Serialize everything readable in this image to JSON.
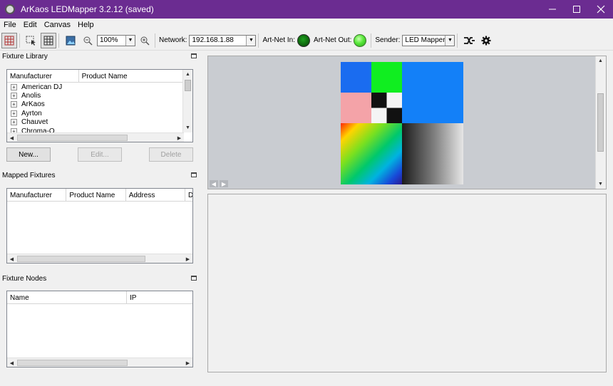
{
  "window": {
    "title": "ArKaos LEDMapper 3.2.12 (saved)",
    "minimize_icon": "minimize-icon",
    "maximize_icon": "maximize-icon",
    "close_icon": "close-icon"
  },
  "menu": [
    "File",
    "Edit",
    "Canvas",
    "Help"
  ],
  "toolbar": {
    "zoom_value": "100%",
    "network_label": "Network:",
    "network_value": "192.168.1.88",
    "artnet_in_label": "Art-Net In:",
    "artnet_out_label": "Art-Net Out:",
    "sender_label": "Sender:",
    "sender_value": "LED Mapper",
    "artnet_in_color": "#0f7a0f",
    "artnet_out_color": "#58e83a"
  },
  "fixture_library": {
    "title": "Fixture Library",
    "columns": [
      "Manufacturer",
      "Product Name"
    ],
    "items": [
      "American DJ",
      "Anolis",
      "ArKaos",
      "Ayrton",
      "Chauvet",
      "Chroma-Q"
    ],
    "new_button": "New...",
    "edit_button": "Edit...",
    "delete_button": "Delete"
  },
  "mapped_fixtures": {
    "title": "Mapped Fixtures",
    "columns": [
      "Manufacturer",
      "Product Name",
      "Address",
      "D"
    ]
  },
  "fixture_nodes": {
    "title": "Fixture Nodes",
    "columns": [
      "Name",
      "IP"
    ]
  },
  "canvas": {
    "colors": {
      "blue": "#1a6cf0",
      "green": "#10ee20",
      "pink": "#f4a3a8",
      "light_blue": "#1380f8",
      "black": "#111111",
      "white": "#f4f4f4"
    }
  }
}
